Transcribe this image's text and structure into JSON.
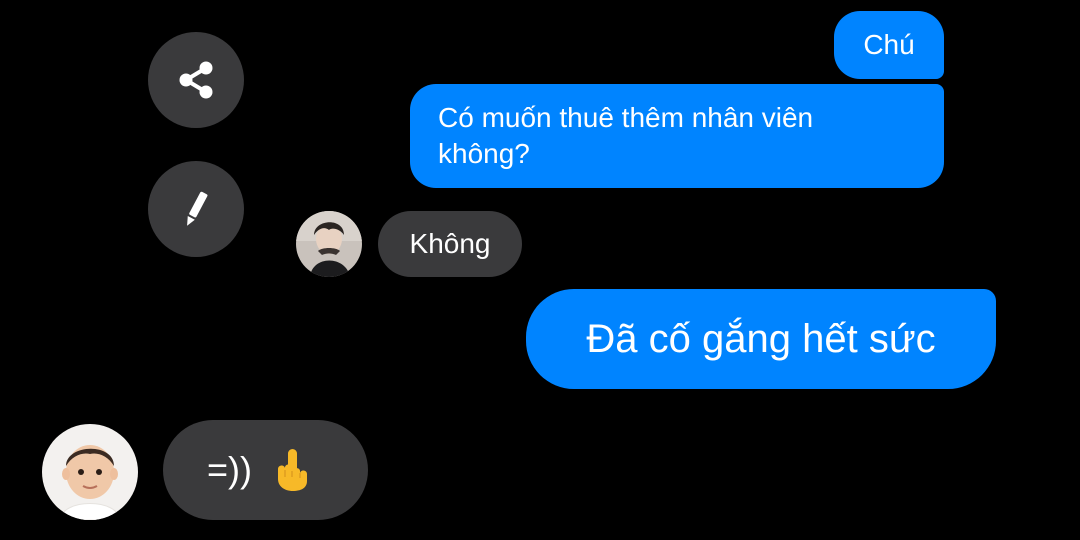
{
  "actions": {
    "share_icon": "share-icon",
    "edit_icon": "pencil-icon"
  },
  "messages": [
    {
      "from": "me",
      "text": "Chú"
    },
    {
      "from": "me",
      "text": "Có muốn thuê thêm nhân viên\nkhông?"
    },
    {
      "from": "friend",
      "text": "Không"
    },
    {
      "from": "me",
      "text": "Đã cố gắng hết sức"
    },
    {
      "from": "other",
      "text": "=))",
      "emoji": "🖕"
    }
  ],
  "colors": {
    "background": "#000000",
    "sent_bubble": "#0084ff",
    "received_bubble": "#3a3a3c",
    "text": "#ffffff"
  }
}
